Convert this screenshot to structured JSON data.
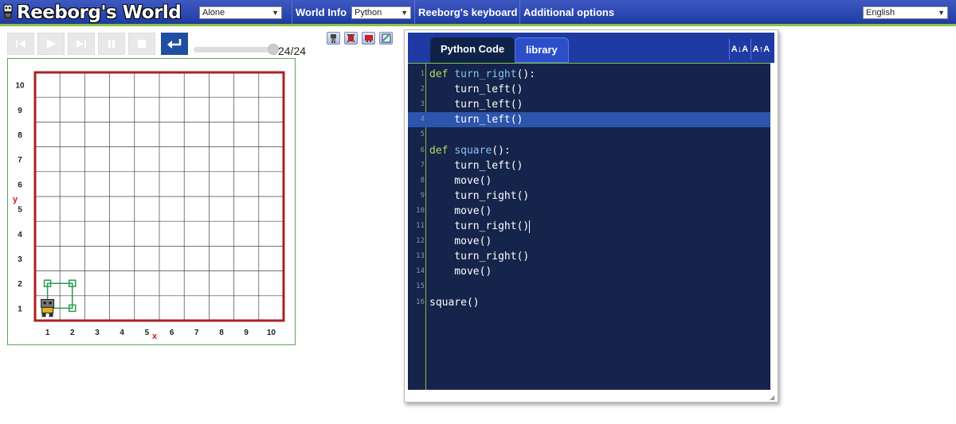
{
  "topbar": {
    "title": "Reeborg's World",
    "mode_select": "Alone",
    "world_info": "World Info",
    "language_select": "Python",
    "keyboard": "Reeborg's keyboard",
    "additional_options": "Additional options",
    "ui_language": "English"
  },
  "controls": {
    "step_display": "24/24",
    "progress": 1.0
  },
  "world": {
    "y_axis_label": "y",
    "x_axis_label": "x",
    "x_ticks": [
      "1",
      "2",
      "3",
      "4",
      "5",
      "6",
      "7",
      "8",
      "9",
      "10"
    ],
    "y_ticks": [
      "1",
      "2",
      "3",
      "4",
      "5",
      "6",
      "7",
      "8",
      "9",
      "10"
    ],
    "wall_color": "#aa2222",
    "trace_color": "#2a9a55",
    "robot_position": [
      1,
      1
    ]
  },
  "editor": {
    "tabs": [
      "Python Code",
      "library"
    ],
    "font_smaller": "A↓A",
    "font_larger": "A↑A",
    "highlighted_line": 4,
    "lines": [
      {
        "n": "1",
        "code": "def turn_right():"
      },
      {
        "n": "2",
        "code": "    turn_left()"
      },
      {
        "n": "3",
        "code": "    turn_left()"
      },
      {
        "n": "4",
        "code": "    turn_left()"
      },
      {
        "n": "5",
        "code": ""
      },
      {
        "n": "6",
        "code": "def square():"
      },
      {
        "n": "7",
        "code": "    turn_left()"
      },
      {
        "n": "8",
        "code": "    move()"
      },
      {
        "n": "9",
        "code": "    turn_right()"
      },
      {
        "n": "10",
        "code": "    move()"
      },
      {
        "n": "11",
        "code": "    turn_right()"
      },
      {
        "n": "12",
        "code": "    move()"
      },
      {
        "n": "13",
        "code": "    turn_right()"
      },
      {
        "n": "14",
        "code": "    move()"
      },
      {
        "n": "15",
        "code": ""
      },
      {
        "n": "16",
        "code": "square()"
      }
    ]
  }
}
